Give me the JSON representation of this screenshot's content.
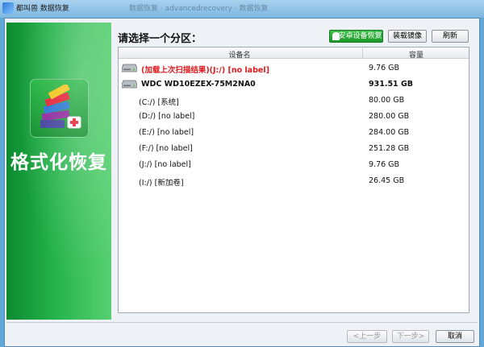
{
  "window": {
    "title": "都叫兽 数据恢复",
    "blurred_title": "  数据恢复  ·  advancedrecovery  ·  数据恢复"
  },
  "sidebar": {
    "banner_text": "格式化恢复"
  },
  "header": {
    "prompt": "请选择一个分区：",
    "android_button": "安卓设备恢复",
    "mirror_button": "装载镜像",
    "refresh_button": "刷新"
  },
  "table": {
    "columns": [
      "设备名",
      "容量"
    ],
    "rows": [
      {
        "name": "(加载上次扫描结果)(J:/) [no label]",
        "capacity": "9.76 GB"
      },
      {
        "name": "WDC WD10EZEX-75M2NA0",
        "capacity": "931.51 GB"
      },
      {
        "name": "(C:/) [系统]",
        "capacity": "80.00 GB"
      },
      {
        "name": "(D:/) [no label]",
        "capacity": "280.00 GB"
      },
      {
        "name": "(E:/) [no label]",
        "capacity": "284.00 GB"
      },
      {
        "name": "(F:/) [no label]",
        "capacity": "251.28 GB"
      },
      {
        "name": "(J:/) [no label]",
        "capacity": "9.76 GB"
      },
      {
        "name": "(I:/) [新加卷]",
        "capacity": "26.45 GB"
      }
    ]
  },
  "footer": {
    "prev_button": "<上一步",
    "next_button": "下一步>",
    "cancel_button": "取消"
  },
  "colors": {
    "banner_green": "#23b24a",
    "last_scan_red": "#e0191d"
  }
}
